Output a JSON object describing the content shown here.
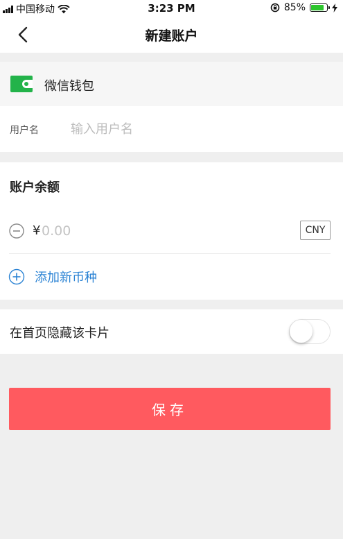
{
  "status_bar": {
    "carrier": "中国移动",
    "time": "3:23 PM",
    "battery_percent": "85%",
    "battery_level": 0.85,
    "icons": [
      "signal-icon",
      "wifi-icon",
      "orientation-lock-icon",
      "battery-icon",
      "charging-icon"
    ]
  },
  "nav": {
    "title": "新建账户",
    "back_icon": "chevron-left-icon"
  },
  "wallet": {
    "label": "微信钱包",
    "icon": "wallet-icon",
    "icon_color": "#23b34a"
  },
  "username": {
    "label": "用户名",
    "placeholder": "输入用户名",
    "value": ""
  },
  "balance": {
    "title": "账户余额",
    "currency_symbol": "¥",
    "amount_placeholder": "0.00",
    "amount_value": "",
    "currency_code": "CNY",
    "remove_icon": "minus-circle-icon",
    "add_currency_label": "添加新币种",
    "add_icon": "plus-circle-icon",
    "accent_color": "#2b83d4"
  },
  "hide_card": {
    "label": "在首页隐藏该卡片",
    "enabled": false
  },
  "save": {
    "label": "保存",
    "color": "#ff5a5f"
  }
}
